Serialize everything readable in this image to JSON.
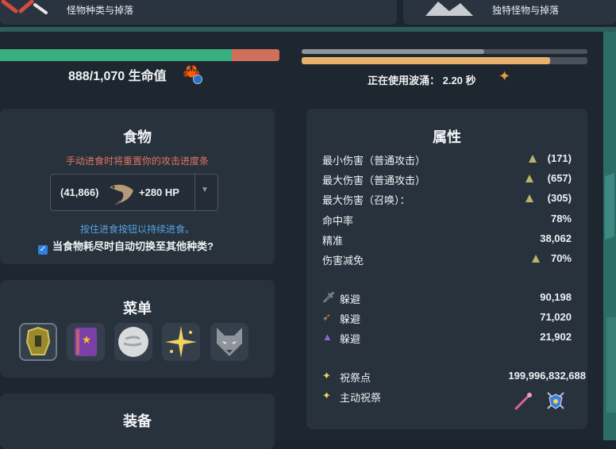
{
  "top_tabs": {
    "left_label": "怪物种类与掉落",
    "right_label": "独特怪物与掉落"
  },
  "health": {
    "text": "888/1,070 生命值",
    "fill_fraction": 0.83
  },
  "attack_progress": {
    "secondary_fraction": 0.64,
    "primary_fraction": 0.87,
    "text": "正在使用波涌： 2.20 秒"
  },
  "food": {
    "title": "食物",
    "warning": "手动进食时将重置你的攻击进度条",
    "count": "(41,866)",
    "heal": "+280 HP",
    "hint": "按住进食按钮以持续进食。",
    "auto_switch_label": "当食物耗尽时自动切换至其他种类?"
  },
  "menu": {
    "title": "菜单",
    "items": [
      {
        "icon": "armor-icon"
      },
      {
        "icon": "spellbook-icon"
      },
      {
        "icon": "wind-icon"
      },
      {
        "icon": "sparkle-icon"
      },
      {
        "icon": "wolf-icon"
      }
    ]
  },
  "equipment": {
    "title": "装备"
  },
  "attributes": {
    "title": "属性",
    "rows": [
      {
        "label": "最小伤害（普通攻击）",
        "value": "(171)",
        "up": true
      },
      {
        "label": "最大伤害（普通攻击）",
        "value": "(657)",
        "up": true
      },
      {
        "label": "最大伤害（召唤）：",
        "value": "(305)",
        "up": true
      },
      {
        "label": "命中率",
        "value": "78%",
        "up": false
      },
      {
        "label": "精准",
        "value": "38,062",
        "up": false
      },
      {
        "label": "伤害减免",
        "value": "70%",
        "up": true
      }
    ],
    "evasion": [
      {
        "icon": "sword-icon",
        "label": "躲避",
        "value": "90,198"
      },
      {
        "icon": "bow-icon",
        "label": "躲避",
        "value": "71,020"
      },
      {
        "icon": "wizard-hat-icon",
        "label": "躲避",
        "value": "21,902"
      }
    ],
    "prayer_points_label": "祝祭点",
    "prayer_points_value": "199,996,832,688",
    "active_prayer_label": "主动祝祭"
  },
  "colors": {
    "health_fill": "#37b07e",
    "health_empty": "#d0705a",
    "attack_fill": "#e8b06b",
    "warning_text": "#e0735f",
    "hint_text": "#56a0e0",
    "up_arrow": "#b9b56a"
  }
}
